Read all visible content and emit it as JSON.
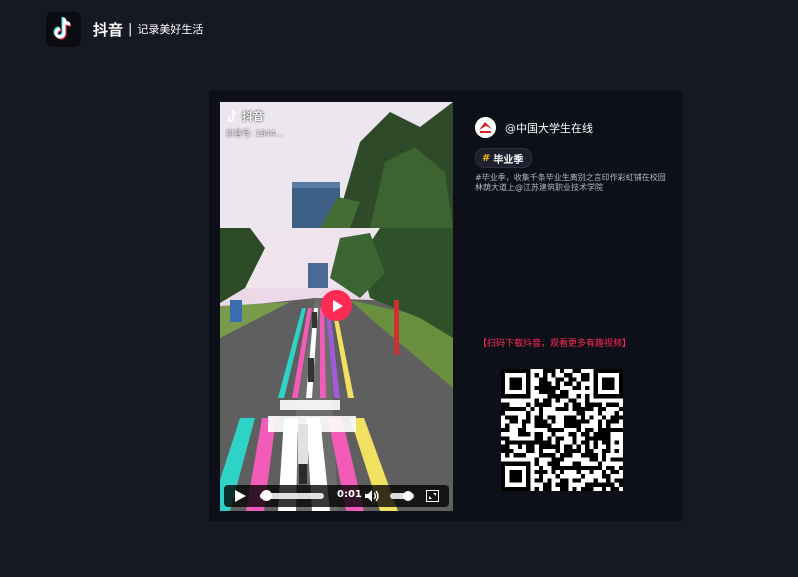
{
  "header": {
    "brand": "抖音",
    "separator": "|",
    "slogan": "记录美好生活"
  },
  "video": {
    "watermark_logo_text": "抖音",
    "watermark_id": "抖音号: 1844...",
    "progress": 0.1,
    "volume": 0.75,
    "time": "0:01"
  },
  "author": {
    "name": "@中国大学生在线"
  },
  "tag": {
    "hash": "#",
    "label": "毕业季"
  },
  "description": "#毕业季，收集千条毕业生离别之言印作彩虹铺在校园林荫大道上@江苏建筑职业技术学院",
  "promo_text": "【扫码下载抖音，观看更多有趣视频】",
  "colors": {
    "background": "#161823",
    "card": "#0d0f19",
    "accent": "#fe2c55",
    "tag_hash": "#f5b800"
  },
  "icons": [
    "douyin-logo-icon",
    "play-icon",
    "volume-icon",
    "fullscreen-icon",
    "qr-code"
  ]
}
